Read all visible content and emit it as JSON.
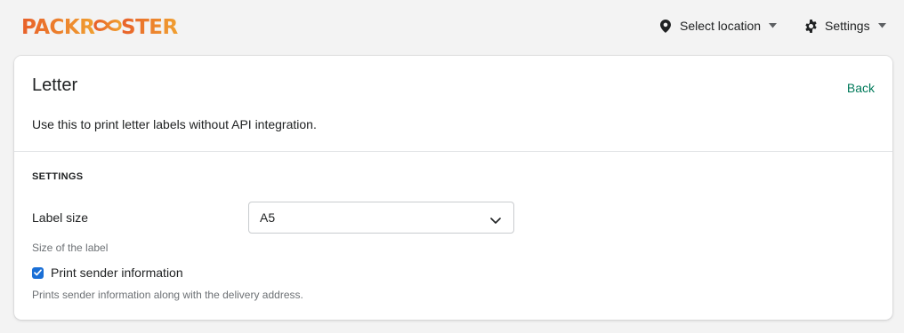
{
  "brand": {
    "logo_text": "PACKROOSTER",
    "colors": {
      "primary": "#e8702a",
      "secondary": "#f0a030"
    }
  },
  "nav": {
    "location_label": "Select location",
    "location_icon": "map-pin-icon",
    "settings_label": "Settings",
    "settings_icon": "gear-icon"
  },
  "card": {
    "title": "Letter",
    "back_label": "Back",
    "description": "Use this to print letter labels without API integration.",
    "section_heading": "SETTINGS",
    "label_size": {
      "label": "Label size",
      "value": "A5",
      "help": "Size of the label"
    },
    "print_sender": {
      "label": "Print sender information",
      "checked": true,
      "help": "Prints sender information along with the delivery address."
    }
  },
  "colors": {
    "link": "#007a5a",
    "checkbox": "#1a6fd6",
    "background": "#f3f3f3"
  }
}
